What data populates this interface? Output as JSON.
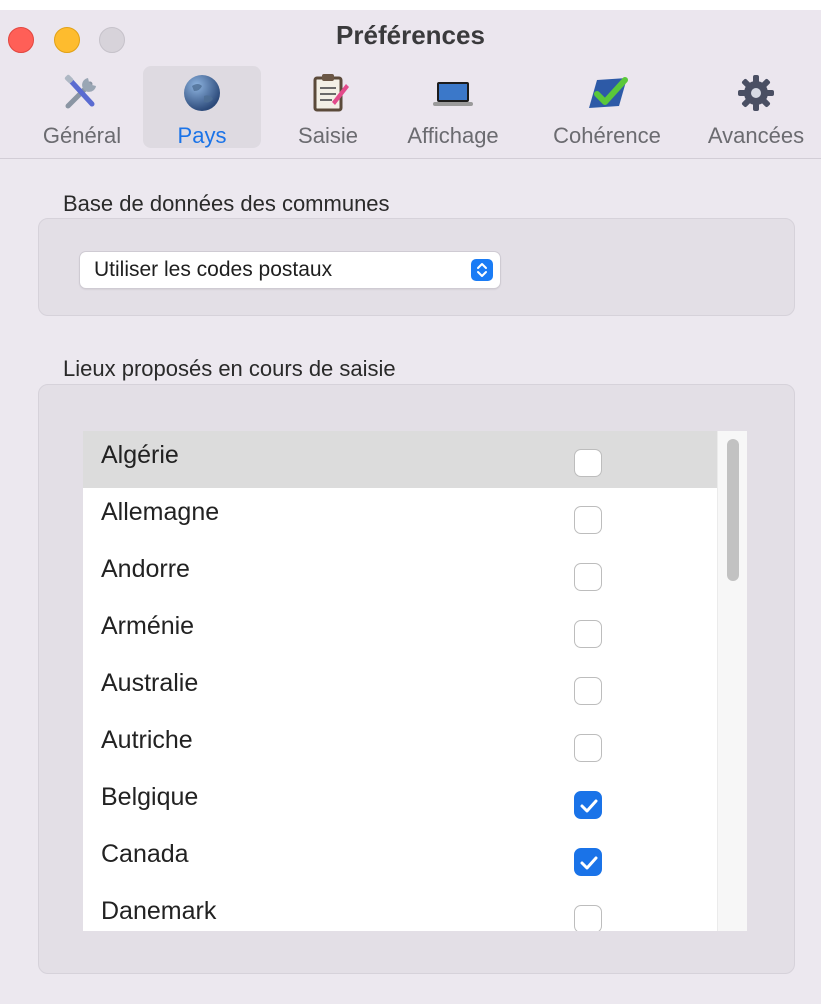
{
  "window": {
    "title": "Préférences"
  },
  "tabs": [
    {
      "label": "Général",
      "icon": "tools-icon"
    },
    {
      "label": "Pays",
      "icon": "globe-icon",
      "selected": true
    },
    {
      "label": "Saisie",
      "icon": "notepad-icon"
    },
    {
      "label": "Affichage",
      "icon": "laptop-icon"
    },
    {
      "label": "Cohérence",
      "icon": "checkmark-icon"
    },
    {
      "label": "Avancées",
      "icon": "gear-icon"
    }
  ],
  "database": {
    "title": "Base de données des communes",
    "popup_value": "Utiliser les codes postaux"
  },
  "places": {
    "title": "Lieux proposés en cours de saisie",
    "items": [
      {
        "name": "Algérie",
        "checked": false
      },
      {
        "name": "Allemagne",
        "checked": false
      },
      {
        "name": "Andorre",
        "checked": false
      },
      {
        "name": "Arménie",
        "checked": false
      },
      {
        "name": "Australie",
        "checked": false
      },
      {
        "name": "Autriche",
        "checked": false
      },
      {
        "name": "Belgique",
        "checked": true
      },
      {
        "name": "Canada",
        "checked": true
      },
      {
        "name": "Danemark",
        "checked": false
      }
    ]
  },
  "colors": {
    "accent": "#1a73e8",
    "selected_row": "#dcdcdc"
  }
}
